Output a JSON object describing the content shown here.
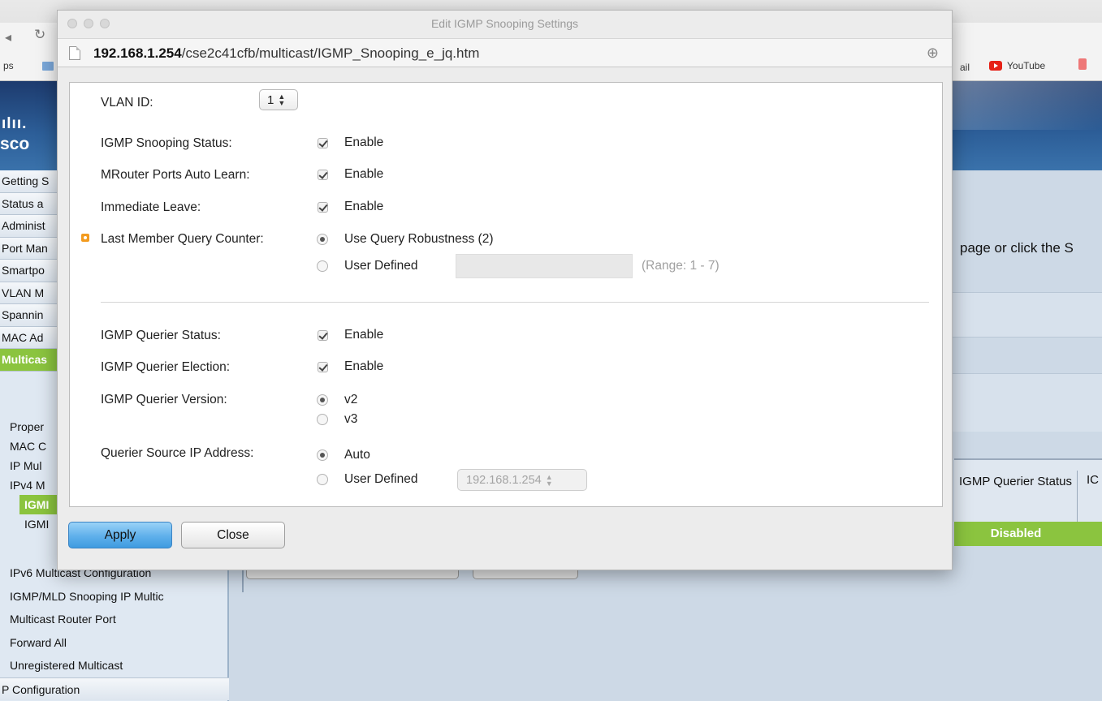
{
  "background": {
    "bookmarks": {
      "apps": "ps",
      "mail": "ail",
      "youtube": "YouTube"
    },
    "logo": {
      "bars": "ılıı.",
      "text": "sco"
    },
    "info_text": "page or click the S",
    "table": {
      "col1": "IGMP Querier Status",
      "col2": "IC",
      "status_value": "Disabled"
    },
    "sidebar": {
      "top_items": [
        "Getting S",
        "Status a",
        "Administ",
        "Port Man",
        "Smartpo",
        "VLAN M",
        "Spannin",
        "MAC Ad",
        "Multicas"
      ],
      "sub_items": [
        "Proper",
        "MAC C",
        "IP Mul",
        "IPv4 M"
      ],
      "deep_items": [
        "IGMI",
        "IGMI"
      ],
      "bottom_items": [
        "IPv6 Multicast Configuration",
        "IGMP/MLD Snooping IP Multic",
        "Multicast Router Port",
        "Forward All",
        "Unregistered Multicast",
        "P Configuration"
      ]
    }
  },
  "dialog": {
    "title": "Edit IGMP Snooping Settings",
    "url_host": "192.168.1.254",
    "url_path": "/cse2c41cfb/multicast/IGMP_Snooping_e_jq.htm",
    "fields": {
      "vlan_id": {
        "label": "VLAN ID:",
        "value": "1"
      },
      "snooping_status": {
        "label": "IGMP Snooping Status:",
        "option": "Enable"
      },
      "mrouter_auto_learn": {
        "label": "MRouter Ports Auto Learn:",
        "option": "Enable"
      },
      "immediate_leave": {
        "label": "Immediate Leave:",
        "option": "Enable"
      },
      "last_member_query": {
        "label": "Last Member Query Counter:",
        "option_robustness": "Use Query Robustness (2)",
        "option_user": "User Defined",
        "range": "(Range: 1 - 7)"
      },
      "querier_status": {
        "label": "IGMP Querier Status:",
        "option": "Enable"
      },
      "querier_election": {
        "label": "IGMP Querier Election:",
        "option": "Enable"
      },
      "querier_version": {
        "label": "IGMP Querier Version:",
        "option_v2": "v2",
        "option_v3": "v3"
      },
      "querier_source_ip": {
        "label": "Querier Source IP Address:",
        "option_auto": "Auto",
        "option_user": "User Defined",
        "ip_value": "192.168.1.254"
      }
    },
    "buttons": {
      "apply": "Apply",
      "close": "Close"
    }
  },
  "colors": {
    "accent_green": "#8bc43f",
    "apply_blue": "#5fb0eb",
    "header_blue": "#2d5f99",
    "required_orange": "#f39b1f"
  }
}
